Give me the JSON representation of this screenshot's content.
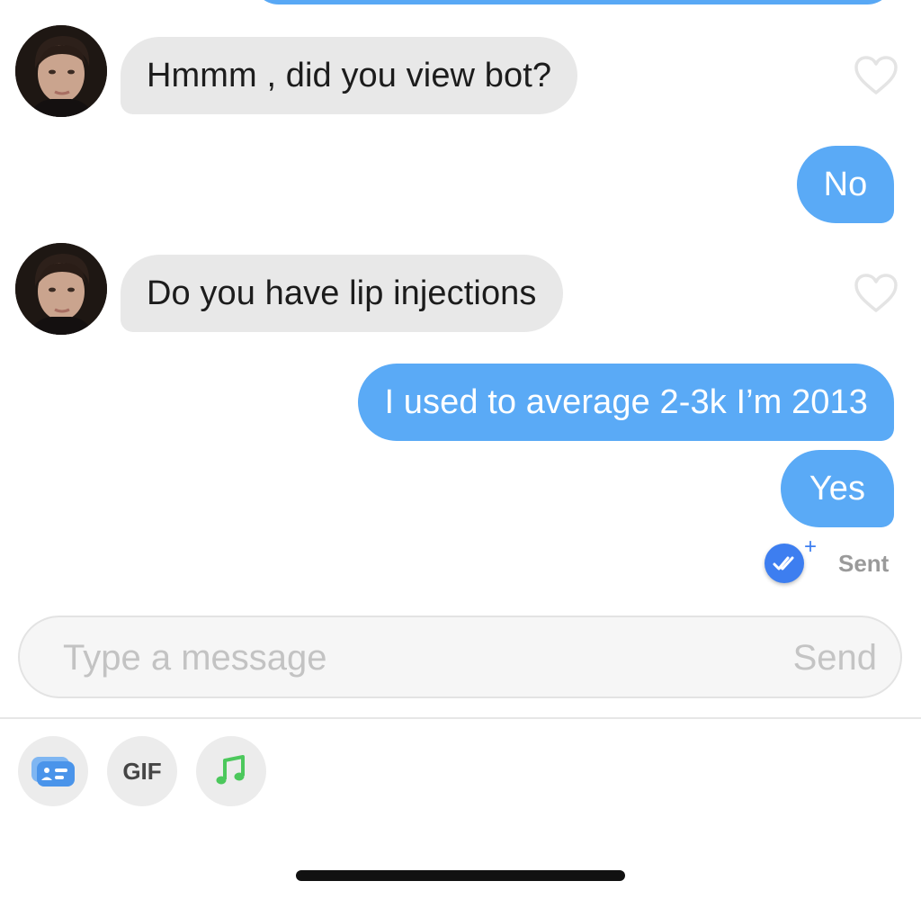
{
  "messages": [
    {
      "direction": "incoming",
      "text": "Hmmm , did you view bot?"
    },
    {
      "direction": "outgoing",
      "text": "No"
    },
    {
      "direction": "incoming",
      "text": "Do you have lip injections"
    },
    {
      "direction": "outgoing",
      "text": "I used to average 2-3k I’m 2013"
    },
    {
      "direction": "outgoing",
      "text": "Yes"
    }
  ],
  "status": {
    "sent_label": "Sent",
    "receipt_plus": "+"
  },
  "composer": {
    "placeholder": "Type a message",
    "send_label": "Send"
  },
  "toolbar": {
    "gif_label": "GIF"
  },
  "colors": {
    "outgoing_bubble": "#5aaaf6",
    "incoming_bubble": "#e8e8e8",
    "read_receipt": "#3d7ef0",
    "music_icon": "#4cc85c"
  },
  "icons": [
    "heart-icon",
    "read-receipt-icon",
    "profile-card-icon",
    "music-note-icon"
  ]
}
